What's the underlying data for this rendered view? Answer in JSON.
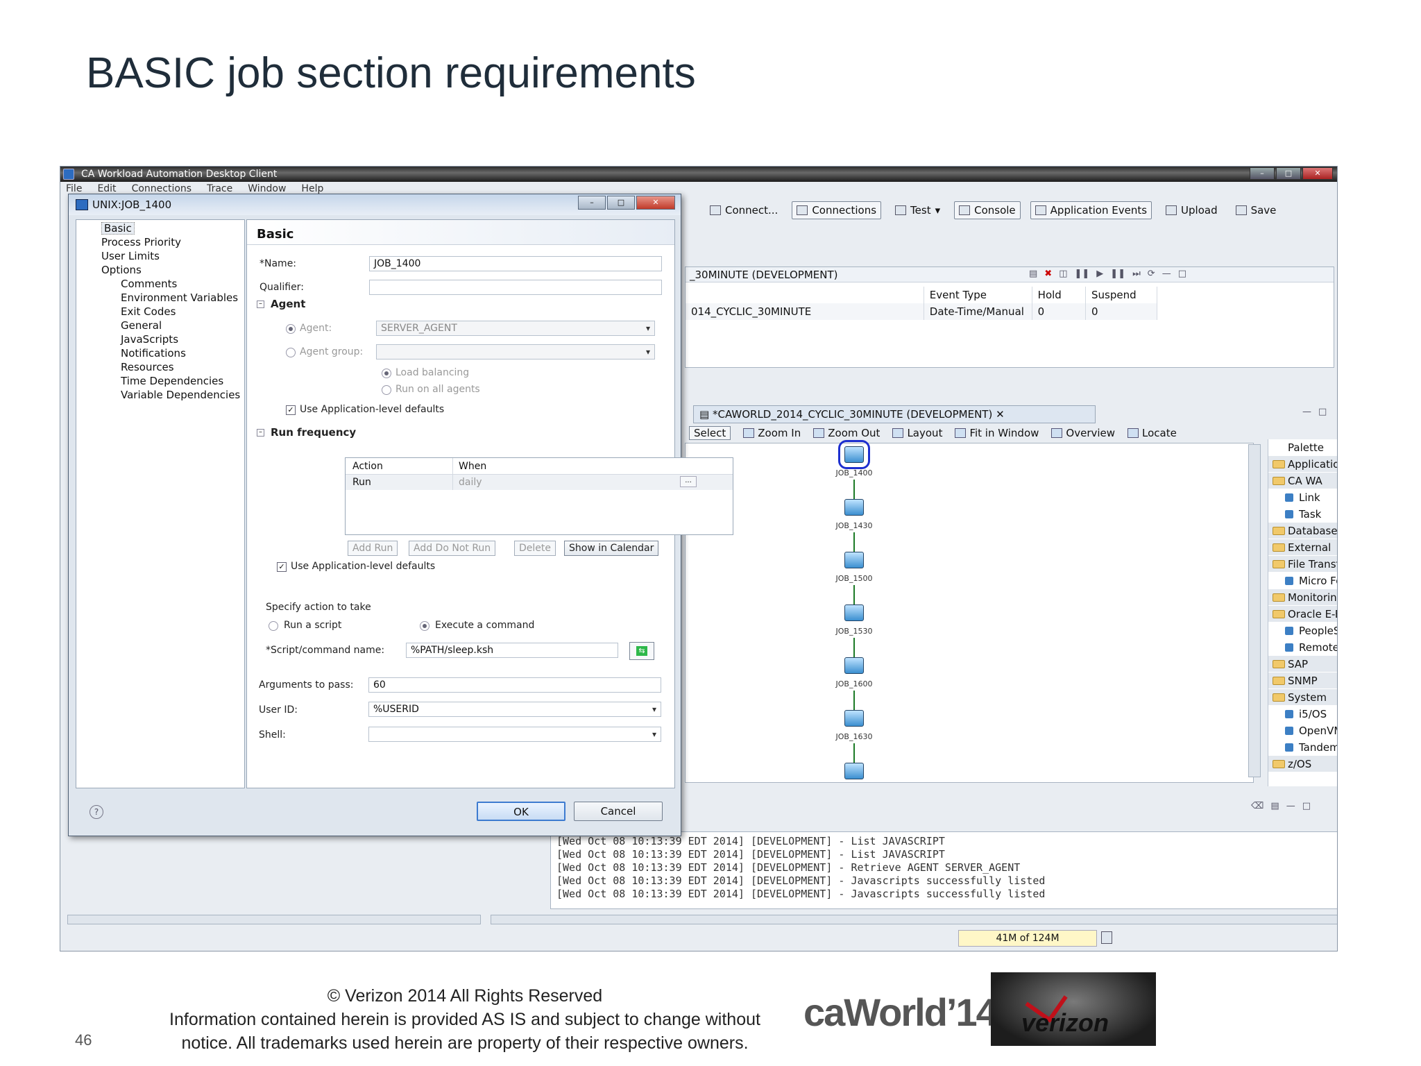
{
  "slide": {
    "title": "BASIC job section requirements",
    "page_number": "46",
    "footer_line1": "© Verizon 2014 All Rights Reserved",
    "footer_line2": "Information contained herein is provided AS IS and subject to change without",
    "footer_line3": "notice.  All trademarks used herein are property of their respective owners.",
    "caworld_logo": "caWorld’14",
    "verizon_logo": "verizon"
  },
  "app": {
    "title": "CA Workload Automation Desktop Client",
    "menu": [
      "File",
      "Edit",
      "Connections",
      "Trace",
      "Window",
      "Help"
    ],
    "toolbar": {
      "connect": "Connect...",
      "connections": "Connections",
      "test": "Test",
      "console": "Console",
      "application_events": "Application Events",
      "upload": "Upload",
      "save": "Save"
    },
    "events_panel": {
      "header": "_30MINUTE (DEVELOPMENT)",
      "columns": [
        "Event Type",
        "Hold",
        "Suspend"
      ],
      "row_name": "014_CYCLIC_30MINUTE",
      "row_values": [
        "Date-Time/Manual",
        "0",
        "0"
      ]
    },
    "diagram": {
      "tab": "*CAWORLD_2014_CYCLIC_30MINUTE (DEVELOPMENT)",
      "tools": [
        "Select",
        "Zoom In",
        "Zoom Out",
        "Layout",
        "Fit in Window",
        "Overview",
        "Locate"
      ],
      "nodes": [
        "JOB_1400",
        "JOB_1430",
        "JOB_1500",
        "JOB_1530",
        "JOB_1600",
        "JOB_1630",
        ""
      ]
    },
    "palette": [
      {
        "label": "Palette",
        "kind": "head"
      },
      {
        "label": "Application and ...",
        "kind": "cat"
      },
      {
        "label": "CA WA",
        "kind": "cat"
      },
      {
        "label": "Link",
        "kind": "sub"
      },
      {
        "label": "Task",
        "kind": "sub"
      },
      {
        "label": "Database",
        "kind": "cat"
      },
      {
        "label": "External",
        "kind": "cat"
      },
      {
        "label": "File Transfer",
        "kind": "cat"
      },
      {
        "label": "Micro Focus",
        "kind": "sub"
      },
      {
        "label": "Monitoring",
        "kind": "cat"
      },
      {
        "label": "Oracle E-Busines...",
        "kind": "cat"
      },
      {
        "label": "PeopleSoft",
        "kind": "sub"
      },
      {
        "label": "RemoteExecuti...",
        "kind": "sub"
      },
      {
        "label": "SAP",
        "kind": "cat"
      },
      {
        "label": "SNMP",
        "kind": "cat"
      },
      {
        "label": "System",
        "kind": "cat"
      },
      {
        "label": "i5/OS",
        "kind": "sub"
      },
      {
        "label": "OpenVMS",
        "kind": "sub"
      },
      {
        "label": "Tandem NSK",
        "kind": "sub"
      },
      {
        "label": "z/OS",
        "kind": "cat"
      }
    ],
    "console_lines": [
      "[Wed Oct 08 10:13:39 EDT 2014] [DEVELOPMENT] - List JAVASCRIPT",
      "[Wed Oct 08 10:13:39 EDT 2014] [DEVELOPMENT] - List JAVASCRIPT",
      "[Wed Oct 08 10:13:39 EDT 2014] [DEVELOPMENT] - Retrieve AGENT SERVER_AGENT",
      "[Wed Oct 08 10:13:39 EDT 2014] [DEVELOPMENT] - Javascripts successfully listed",
      "[Wed Oct 08 10:13:39 EDT 2014] [DEVELOPMENT] - Javascripts successfully listed"
    ],
    "memory": "41M of 124M"
  },
  "dialog": {
    "title": "UNIX:JOB_1400",
    "tree": [
      {
        "label": "Basic",
        "level": 1,
        "selected": true
      },
      {
        "label": "Process Priority",
        "level": 1
      },
      {
        "label": "User Limits",
        "level": 1
      },
      {
        "label": "Options",
        "level": 1
      },
      {
        "label": "Comments",
        "level": 2
      },
      {
        "label": "Environment Variables",
        "level": 2
      },
      {
        "label": "Exit Codes",
        "level": 2
      },
      {
        "label": "General",
        "level": 2
      },
      {
        "label": "JavaScripts",
        "level": 2
      },
      {
        "label": "Notifications",
        "level": 2
      },
      {
        "label": "Resources",
        "level": 2
      },
      {
        "label": "Time Dependencies",
        "level": 2
      },
      {
        "label": "Variable Dependencies",
        "level": 2
      }
    ],
    "section_title": "Basic",
    "name_label": "*Name:",
    "name_value": "JOB_1400",
    "qualifier_label": "Qualifier:",
    "qualifier_value": "",
    "agent_section": "Agent",
    "agent_label": "Agent:",
    "agent_value": "SERVER_AGENT",
    "agent_group_label": "Agent group:",
    "load_balancing": "Load balancing",
    "run_all_agents": "Run on all agents",
    "use_app_defaults": "Use Application-level defaults",
    "run_freq_section": "Run frequency",
    "run_table": {
      "col_action": "Action",
      "col_when": "When",
      "row_action": "Run",
      "row_when": "daily"
    },
    "run_buttons": {
      "add_run": "Add Run",
      "add_do_not_run": "Add Do Not Run",
      "delete": "Delete",
      "show_calendar": "Show in Calendar"
    },
    "use_app_defaults2": "Use Application-level defaults",
    "specify_action": "Specify action to take",
    "run_script": "Run a script",
    "execute_command": "Execute a command",
    "script_label": "*Script/command name:",
    "script_value": "%PATH/sleep.ksh",
    "args_label": "Arguments to pass:",
    "args_value": "60",
    "userid_label": "User ID:",
    "userid_value": "%USERID",
    "shell_label": "Shell:",
    "shell_value": "",
    "ok": "OK",
    "cancel": "Cancel"
  }
}
